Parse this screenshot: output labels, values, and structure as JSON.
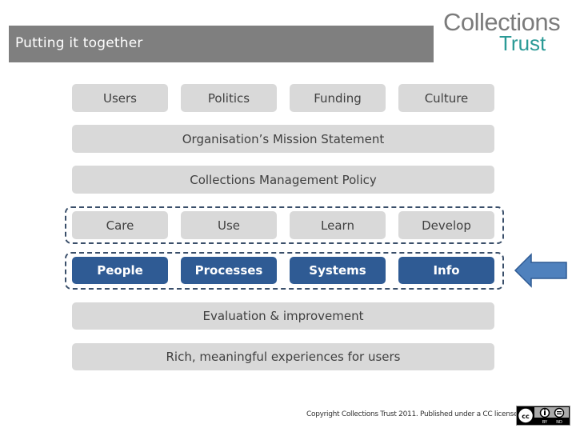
{
  "header": {
    "title": "Putting it together"
  },
  "logo": {
    "line1": "Collections",
    "line2": "Trust",
    "colors": {
      "line1": "#7b7b7b",
      "line2": "#2b9a96"
    }
  },
  "context_row": [
    "Users",
    "Politics",
    "Funding",
    "Culture"
  ],
  "mission": "Organisation’s Mission Statement",
  "policy": "Collections Management Policy",
  "activities_row": [
    "Care",
    "Use",
    "Learn",
    "Develop"
  ],
  "resources_row": [
    "People",
    "Processes",
    "Systems",
    "Info"
  ],
  "evaluation": "Evaluation & improvement",
  "outcome": "Rich, meaningful experiences for users",
  "arrow": {
    "icon": "left-arrow-icon",
    "points_to": "resources_row",
    "color": "#4f81bd"
  },
  "footer": {
    "copyright": "Copyright Collections Trust 2011. Published under a CC license",
    "license_badge": {
      "icon": "cc-by-nd-icon",
      "labels": [
        "cc",
        "BY",
        "ND"
      ]
    }
  },
  "colors": {
    "grey_box": "#d9d9d9",
    "blue_box": "#2f5b94",
    "title_bar": "#7f7f7f",
    "dash_border": "#3a4f6a"
  }
}
